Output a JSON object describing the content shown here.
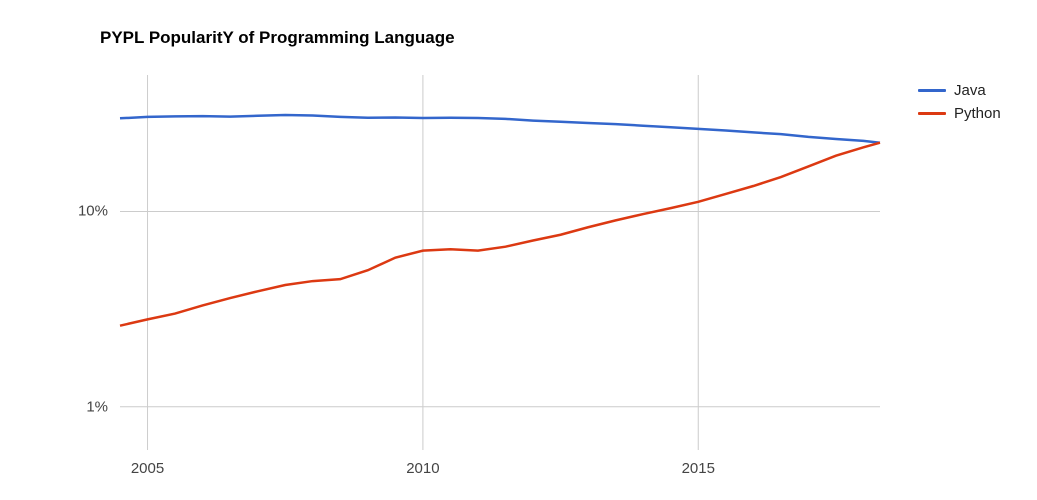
{
  "chart_data": {
    "type": "line",
    "title": "PYPL PopularitY of Programming Language",
    "xlabel": "",
    "ylabel": "",
    "x_years": [
      2004.5,
      2005,
      2005.5,
      2006,
      2006.5,
      2007,
      2007.5,
      2008,
      2008.5,
      2009,
      2009.5,
      2010,
      2010.5,
      2011,
      2011.5,
      2012,
      2012.5,
      2013,
      2013.5,
      2014,
      2014.5,
      2015,
      2015.5,
      2016,
      2016.5,
      2017,
      2017.5,
      2018,
      2018.3
    ],
    "series": [
      {
        "name": "Java",
        "color": "#3366cc",
        "values": [
          30.0,
          30.5,
          30.7,
          30.8,
          30.6,
          30.9,
          31.2,
          31.0,
          30.5,
          30.2,
          30.3,
          30.1,
          30.2,
          30.1,
          29.8,
          29.2,
          28.8,
          28.4,
          28.0,
          27.5,
          27.0,
          26.5,
          26.0,
          25.4,
          24.9,
          24.1,
          23.5,
          23.0,
          22.5
        ]
      },
      {
        "name": "Python",
        "color": "#dc3912",
        "values": [
          2.6,
          2.8,
          3.0,
          3.3,
          3.6,
          3.9,
          4.2,
          4.4,
          4.5,
          5.0,
          5.8,
          6.3,
          6.4,
          6.3,
          6.6,
          7.1,
          7.6,
          8.3,
          9.0,
          9.7,
          10.4,
          11.2,
          12.3,
          13.5,
          15.0,
          17.0,
          19.3,
          21.3,
          22.5
        ]
      }
    ],
    "x_ticks": [
      2005,
      2010,
      2015
    ],
    "y_ticks_percent": [
      1,
      10
    ],
    "y_scale": "log",
    "x_range": [
      2004.5,
      2018.3
    ],
    "y_range_percent": [
      0.6,
      50
    ]
  }
}
